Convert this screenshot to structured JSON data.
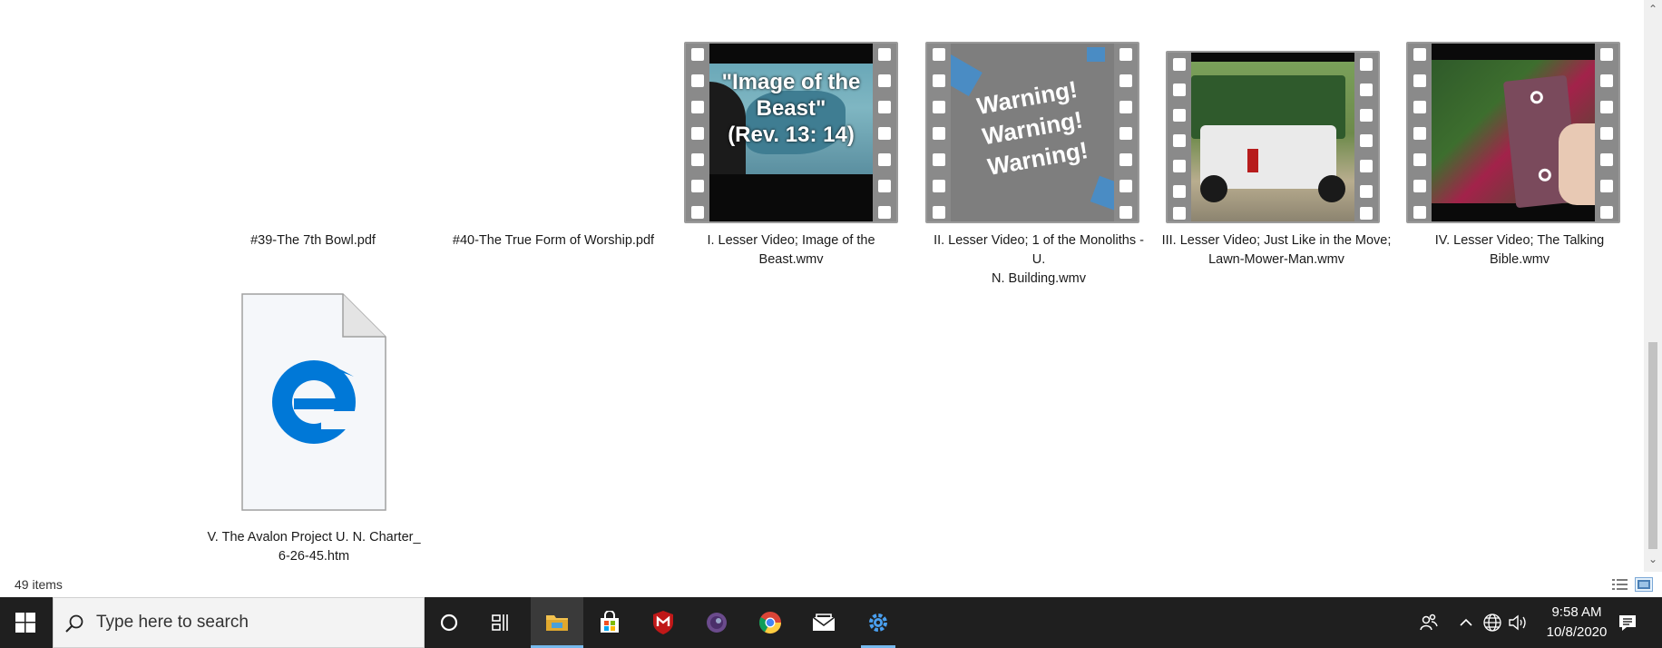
{
  "files": {
    "row1": [
      {
        "name": "#39-The 7th Bowl.pdf"
      },
      {
        "name": "#40-The True Form of Worship.pdf"
      },
      {
        "name": "I. Lesser Video; Image of the\nBeast.wmv",
        "thumb_text": "\"Image of the\nBeast\"\n(Rev. 13: 14)"
      },
      {
        "name": "II. Lesser Video; 1 of the Monoliths - U.\nN. Building.wmv",
        "thumb_text": "Warning!\nWarning!\nWarning!"
      },
      {
        "name": "III. Lesser Video; Just Like in the Move;\nLawn-Mower-Man.wmv"
      },
      {
        "name": "IV. Lesser Video; The Talking Bible.wmv"
      }
    ],
    "row2": [
      {
        "name": "V. The Avalon Project U. N. Charter_\n6-26-45.htm",
        "icon": "edge-document-icon"
      }
    ]
  },
  "status": {
    "item_count": "49 items",
    "view_buttons": [
      "details-view-icon",
      "large-icons-view-icon"
    ]
  },
  "taskbar": {
    "search_placeholder": "Type here to search",
    "apps": [
      "cortana-icon",
      "task-view-icon",
      "file-explorer-icon",
      "microsoft-store-icon",
      "mcafee-icon",
      "tor-browser-icon",
      "chrome-icon",
      "mail-icon",
      "settings-icon"
    ],
    "active_app": "file-explorer-icon",
    "time": "9:58 AM",
    "date": "10/8/2020"
  },
  "colors": {
    "taskbar_bg": "#1f1f1f",
    "accent": "#76b9ed",
    "edge_blue": "#0078d7"
  }
}
